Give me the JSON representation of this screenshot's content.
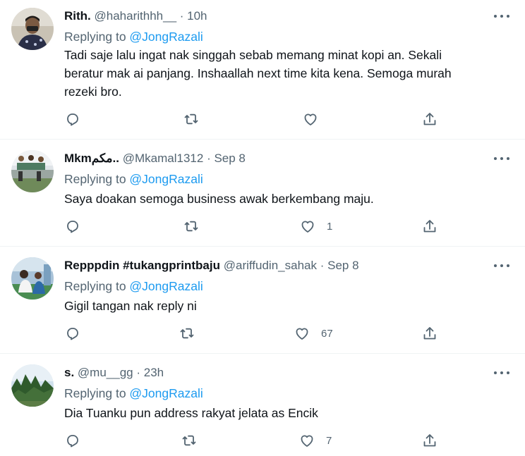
{
  "colors": {
    "link": "#1d9bf0",
    "muted": "#536471",
    "text": "#0f1419",
    "divider": "#eff3f4"
  },
  "icons": {
    "reply": "reply-icon",
    "retweet": "retweet-icon",
    "like": "heart-icon",
    "share": "share-icon",
    "more": "more-icon"
  },
  "tweets": [
    {
      "name": "Rith.",
      "handle": "@haharithhh__",
      "time": "· 10h",
      "replying_prefix": "Replying to ",
      "replying_handle": "@JongRazali",
      "text_lines": [
        "Tadi saje lalu ingat nak singgah sebab memang minat kopi an. Sekali",
        "beratur mak ai panjang. Inshaallah next time kita kena. Semoga murah",
        "rezeki bro."
      ],
      "likes": ""
    },
    {
      "name": "Mkmمكم..",
      "handle": "@Mkamal1312",
      "time": "· Sep 8",
      "replying_prefix": "Replying to ",
      "replying_handle": "@JongRazali",
      "text_lines": [
        "Saya doakan semoga business awak berkembang maju."
      ],
      "likes": "1"
    },
    {
      "name": "Repppdin #tukangprintbaju",
      "handle": "@ariffudin_sahak",
      "time": "· Sep 8",
      "replying_prefix": "Replying to ",
      "replying_handle": "@JongRazali",
      "text_lines": [
        "Gigil tangan nak reply ni"
      ],
      "likes": "67"
    },
    {
      "name": "s.",
      "handle": "@mu__gg",
      "time": "· 23h",
      "replying_prefix": "Replying to ",
      "replying_handle": "@JongRazali",
      "text_lines": [
        "Dia Tuanku pun address rakyat jelata as Encik"
      ],
      "likes": "7"
    }
  ]
}
